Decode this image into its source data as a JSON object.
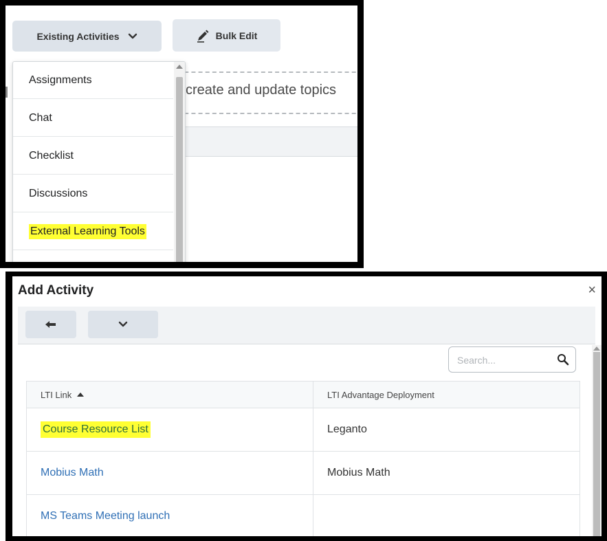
{
  "top_panel": {
    "existing_activities_label": "Existing Activities",
    "bulk_edit_label": "Bulk Edit",
    "background_text": "create and update topics",
    "dropdown_items": [
      {
        "label": "Assignments",
        "highlighted": false
      },
      {
        "label": "Chat",
        "highlighted": false
      },
      {
        "label": "Checklist",
        "highlighted": false
      },
      {
        "label": "Discussions",
        "highlighted": false
      },
      {
        "label": "External Learning Tools",
        "highlighted": true
      }
    ]
  },
  "dialog": {
    "title": "Add Activity",
    "close_label": "×",
    "search_placeholder": "Search...",
    "columns": [
      "LTI Link",
      "LTI Advantage Deployment"
    ],
    "rows": [
      {
        "link": "Course Resource List",
        "deployment": "Leganto",
        "highlighted": true
      },
      {
        "link": "Mobius Math",
        "deployment": "Mobius Math",
        "highlighted": false
      },
      {
        "link": "MS Teams Meeting launch",
        "deployment": "",
        "highlighted": false
      }
    ]
  },
  "colors": {
    "highlight": "#ffff33",
    "link": "#2f6fb5",
    "button_bg": "#dde3ea"
  },
  "icons": [
    "chevron-down-icon",
    "pencil-icon",
    "back-arrow-icon",
    "search-icon",
    "close-icon",
    "sort-ascending-icon"
  ]
}
